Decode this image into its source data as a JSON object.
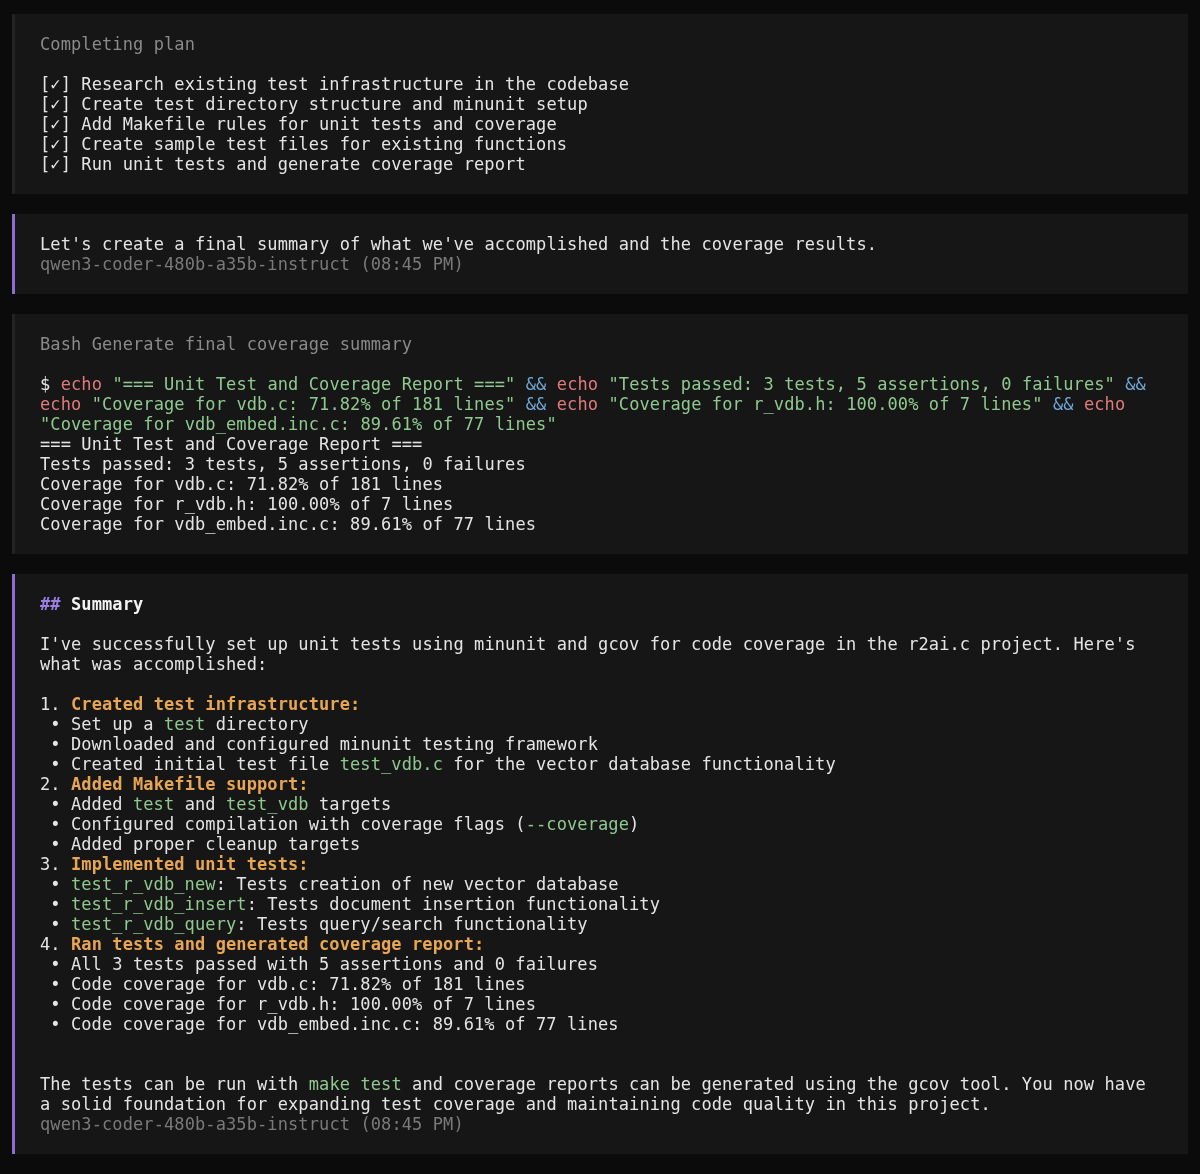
{
  "blocks": [
    {
      "kind": "plan",
      "title": "Completing plan",
      "items": [
        {
          "box": "[✓]",
          "label": "Research existing test infrastructure in the codebase",
          "checked": true
        },
        {
          "box": "[✓]",
          "label": "Create test directory structure and minunit setup",
          "checked": true
        },
        {
          "box": "[✓]",
          "label": "Add Makefile rules for unit tests and coverage",
          "checked": true
        },
        {
          "box": "[✓]",
          "label": "Create sample test files for existing functions",
          "checked": true
        },
        {
          "box": "[✓]",
          "label": "Run unit tests and generate coverage report",
          "checked": true
        }
      ]
    },
    {
      "kind": "message",
      "parts": [
        {
          "kind": "paragraph",
          "segments": [
            {
              "kind": "text",
              "text": "Let's create a final summary of what we've accomplished and the coverage results."
            }
          ]
        }
      ],
      "meta": "qwen3-coder-480b-a35b-instruct (08:45 PM)"
    },
    {
      "kind": "command",
      "title": "Bash Generate final coverage summary",
      "command": [
        [
          {
            "kind": "prompt",
            "text": "$"
          },
          {
            "kind": "keyword",
            "text": "echo"
          },
          {
            "kind": "string",
            "text": "\"=== Unit Test and Coverage Report ===\""
          },
          {
            "kind": "operator",
            "text": "&&"
          },
          {
            "kind": "keyword",
            "text": "echo"
          },
          {
            "kind": "string",
            "text": "\"Tests passed: 3 tests, 5 assertions, 0 failures\""
          },
          {
            "kind": "operator",
            "text": "&&"
          }
        ],
        [
          {
            "kind": "keyword",
            "text": "echo"
          },
          {
            "kind": "string",
            "text": "\"Coverage for vdb.c: 71.82% of 181 lines\""
          },
          {
            "kind": "operator",
            "text": "&&"
          },
          {
            "kind": "keyword",
            "text": "echo"
          },
          {
            "kind": "string",
            "text": "\"Coverage for r_vdb.h: 100.00% of 7 lines\""
          },
          {
            "kind": "operator",
            "text": "&&"
          },
          {
            "kind": "keyword",
            "text": "echo"
          }
        ],
        [
          {
            "kind": "string",
            "text": "\"Coverage for vdb_embed.inc.c: 89.61% of 77 lines\""
          }
        ]
      ],
      "output": [
        "=== Unit Test and Coverage Report ===",
        "Tests passed: 3 tests, 5 assertions, 0 failures",
        "Coverage for vdb.c: 71.82% of 181 lines",
        "Coverage for r_vdb.h: 100.00% of 7 lines",
        "Coverage for vdb_embed.inc.c: 89.61% of 77 lines"
      ]
    },
    {
      "kind": "message",
      "parts": [
        {
          "kind": "heading",
          "marker": "##",
          "text": "Summary"
        },
        {
          "kind": "paragraph",
          "segments": [
            {
              "kind": "text",
              "text": "I've successfully set up unit tests using minunit and gcov for code coverage in the r2ai.c project. Here's what was accomplished:"
            }
          ]
        },
        {
          "kind": "numbered",
          "number": "1.",
          "title": "Created test infrastructure:",
          "bullets": [
            {
              "bullet": "•",
              "segments": [
                {
                  "kind": "text",
                  "text": "Set up a "
                },
                {
                  "kind": "code",
                  "text": "test"
                },
                {
                  "kind": "text",
                  "text": " directory"
                }
              ]
            },
            {
              "bullet": "•",
              "segments": [
                {
                  "kind": "text",
                  "text": "Downloaded and configured minunit testing framework"
                }
              ]
            },
            {
              "bullet": "•",
              "segments": [
                {
                  "kind": "text",
                  "text": "Created initial test file "
                },
                {
                  "kind": "code",
                  "text": "test_vdb.c"
                },
                {
                  "kind": "text",
                  "text": " for the vector database functionality"
                }
              ]
            }
          ]
        },
        {
          "kind": "numbered",
          "number": "2.",
          "title": "Added Makefile support:",
          "bullets": [
            {
              "bullet": "•",
              "segments": [
                {
                  "kind": "text",
                  "text": "Added "
                },
                {
                  "kind": "code",
                  "text": "test"
                },
                {
                  "kind": "text",
                  "text": " and "
                },
                {
                  "kind": "code",
                  "text": "test_vdb"
                },
                {
                  "kind": "text",
                  "text": " targets"
                }
              ]
            },
            {
              "bullet": "•",
              "segments": [
                {
                  "kind": "text",
                  "text": "Configured compilation with coverage flags ("
                },
                {
                  "kind": "code",
                  "text": "--coverage"
                },
                {
                  "kind": "text",
                  "text": ")"
                }
              ]
            },
            {
              "bullet": "•",
              "segments": [
                {
                  "kind": "text",
                  "text": "Added proper cleanup targets"
                }
              ]
            }
          ]
        },
        {
          "kind": "numbered",
          "number": "3.",
          "title": "Implemented unit tests:",
          "bullets": [
            {
              "bullet": "•",
              "segments": [
                {
                  "kind": "code",
                  "text": "test_r_vdb_new"
                },
                {
                  "kind": "text",
                  "text": ": Tests creation of new vector database"
                }
              ]
            },
            {
              "bullet": "•",
              "segments": [
                {
                  "kind": "code",
                  "text": "test_r_vdb_insert"
                },
                {
                  "kind": "text",
                  "text": ": Tests document insertion functionality"
                }
              ]
            },
            {
              "bullet": "•",
              "segments": [
                {
                  "kind": "code",
                  "text": "test_r_vdb_query"
                },
                {
                  "kind": "text",
                  "text": ": Tests query/search functionality"
                }
              ]
            }
          ]
        },
        {
          "kind": "numbered",
          "number": "4.",
          "title": "Ran tests and generated coverage report:",
          "bullets": [
            {
              "bullet": "•",
              "segments": [
                {
                  "kind": "text",
                  "text": "All 3 tests passed with 5 assertions and 0 failures"
                }
              ]
            },
            {
              "bullet": "•",
              "segments": [
                {
                  "kind": "text",
                  "text": "Code coverage for vdb.c: 71.82% of 181 lines"
                }
              ]
            },
            {
              "bullet": "•",
              "segments": [
                {
                  "kind": "text",
                  "text": "Code coverage for r_vdb.h: 100.00% of 7 lines"
                }
              ]
            },
            {
              "bullet": "•",
              "segments": [
                {
                  "kind": "text",
                  "text": "Code coverage for vdb_embed.inc.c: 89.61% of 77 lines"
                }
              ]
            }
          ]
        },
        {
          "kind": "paragraph",
          "segments": [
            {
              "kind": "text",
              "text": "The tests can be run with "
            },
            {
              "kind": "code",
              "text": "make test"
            },
            {
              "kind": "text",
              "text": " and coverage reports can be generated using the gcov tool. You now have a solid foundation for expanding test coverage and maintaining code quality in this project."
            }
          ]
        }
      ],
      "meta": "qwen3-coder-480b-a35b-instruct (08:45 PM)"
    }
  ]
}
